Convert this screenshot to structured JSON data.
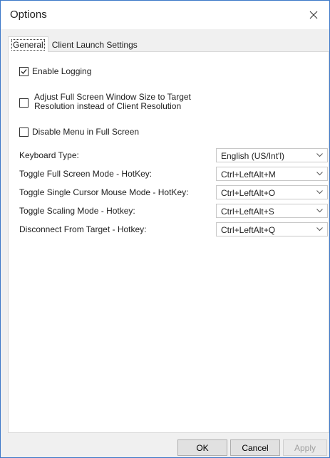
{
  "window": {
    "title": "Options"
  },
  "tabs": [
    {
      "label": "General",
      "active": true
    },
    {
      "label": "Client Launch Settings",
      "active": false
    }
  ],
  "checkboxes": {
    "enable_logging": {
      "label": "Enable Logging",
      "checked": true
    },
    "adjust_full_screen": {
      "label_line1": "Adjust Full Screen Window Size to Target",
      "label_line2": "Resolution instead of Client Resolution",
      "checked": false
    },
    "disable_menu": {
      "label": "Disable Menu in Full Screen",
      "checked": false
    }
  },
  "fields": {
    "keyboard_type": {
      "label": "Keyboard Type:",
      "value": "English (US/Int'l)"
    },
    "toggle_full_screen": {
      "label": "Toggle Full Screen Mode - HotKey:",
      "value": "Ctrl+LeftAlt+M"
    },
    "toggle_single_cursor": {
      "label": "Toggle Single Cursor Mouse Mode - HotKey:",
      "value": "Ctrl+LeftAlt+O"
    },
    "toggle_scaling": {
      "label": "Toggle Scaling Mode - Hotkey:",
      "value": "Ctrl+LeftAlt+S"
    },
    "disconnect": {
      "label": "Disconnect From Target - Hotkey:",
      "value": "Ctrl+LeftAlt+Q"
    }
  },
  "buttons": {
    "ok": "OK",
    "cancel": "Cancel",
    "apply": "Apply"
  },
  "icons": {
    "close": "close-icon",
    "check": "check-icon",
    "dropdown": "chevron-down-icon"
  },
  "colors": {
    "window_border": "#3c78c8",
    "panel_bg": "#ffffff",
    "dialog_bg": "#f0f0f0"
  }
}
